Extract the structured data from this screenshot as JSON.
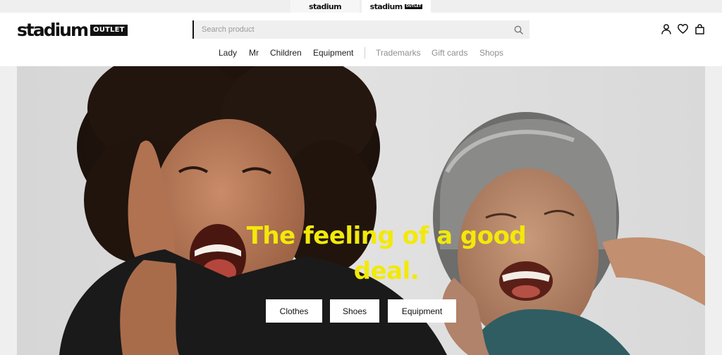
{
  "brand_switch": {
    "stadium": "stadium",
    "outlet_word": "stadium",
    "outlet_badge": "OUTLET"
  },
  "header": {
    "logo_word": "stadium",
    "logo_badge": "OUTLET",
    "search_placeholder": "Search product"
  },
  "nav": {
    "main": [
      {
        "label": "Lady"
      },
      {
        "label": "Mr"
      },
      {
        "label": "Children"
      },
      {
        "label": "Equipment"
      }
    ],
    "secondary": [
      {
        "label": "Trademarks"
      },
      {
        "label": "Gift cards"
      },
      {
        "label": "Shops"
      }
    ]
  },
  "hero": {
    "title_line1": "The feeling of a good",
    "title_line2": "deal.",
    "buttons": [
      {
        "label": "Clothes"
      },
      {
        "label": "Shoes"
      },
      {
        "label": "Equipment"
      }
    ]
  },
  "colors": {
    "accent_yellow": "#f2e90a",
    "text_dark": "#111111",
    "nav_muted": "#8f8f8f"
  },
  "icons": [
    "search-icon",
    "user-icon",
    "heart-icon",
    "bag-icon"
  ]
}
